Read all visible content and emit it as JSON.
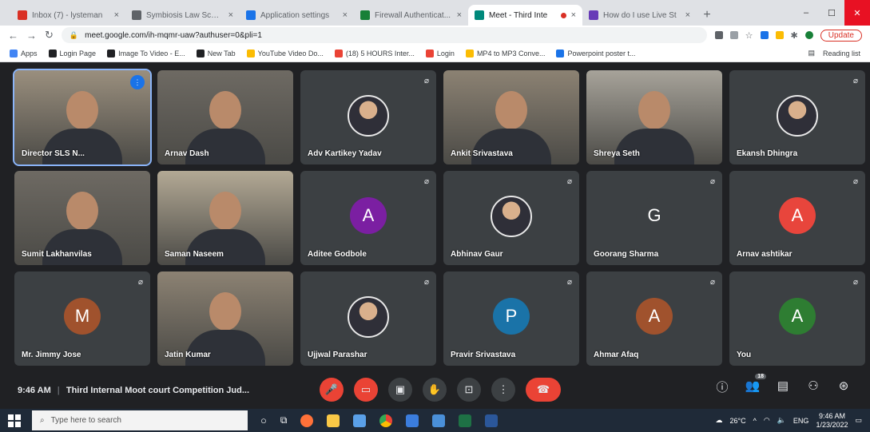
{
  "browser": {
    "tabs": [
      {
        "label": "Inbox (7) - lysteman",
        "color": "#d93025",
        "active": false
      },
      {
        "label": "Symbiosis Law School",
        "color": "#5f6368",
        "active": false
      },
      {
        "label": "Application settings",
        "color": "#1a73e8",
        "active": false
      },
      {
        "label": "Firewall Authenticat...",
        "color": "#188038",
        "active": false
      },
      {
        "label": "Meet - Third Inte",
        "color": "#00897b",
        "active": true
      },
      {
        "label": "How do I use Live St",
        "color": "#673ab7",
        "active": false
      }
    ],
    "new_tab": "+",
    "window_controls": {
      "minimize": "–",
      "maximize": "☐",
      "close": "✕"
    },
    "url": "meet.google.com/ih-mqmr-uaw?authuser=0&pli=1",
    "update_label": "Update",
    "bookmarks": [
      {
        "label": "Apps",
        "color": "#4285f4"
      },
      {
        "label": "Login Page",
        "color": "#202124"
      },
      {
        "label": "Image To Video - E...",
        "color": "#202124"
      },
      {
        "label": "New Tab",
        "color": "#202124"
      },
      {
        "label": "YouTube Video Do...",
        "color": "#fbbc04"
      },
      {
        "label": "(18) 5 HOURS Inter...",
        "color": "#ea4335"
      },
      {
        "label": "Login",
        "color": "#ea4335"
      },
      {
        "label": "MP4 to MP3 Conve...",
        "color": "#fbbc04"
      },
      {
        "label": "Powerpoint poster t...",
        "color": "#1a73e8"
      }
    ],
    "reading_list": "Reading list"
  },
  "participants": [
    {
      "name": "Director SLS N...",
      "type": "video",
      "speaking": true
    },
    {
      "name": "Arnav Dash",
      "type": "video"
    },
    {
      "name": "Adv Kartikey Yadav",
      "type": "photo"
    },
    {
      "name": "Ankit Srivastava",
      "type": "video"
    },
    {
      "name": "Shreya Seth",
      "type": "video"
    },
    {
      "name": "Ekansh Dhingra",
      "type": "photo"
    },
    {
      "name": "Sumit Lakhanvilas",
      "type": "video"
    },
    {
      "name": "Saman Naseem",
      "type": "video"
    },
    {
      "name": "Aditee Godbole",
      "type": "letter",
      "letter": "A",
      "color": "#7b1fa2"
    },
    {
      "name": "Abhinav Gaur",
      "type": "photo"
    },
    {
      "name": "Goorang Sharma",
      "type": "letter",
      "letter": "G",
      "color": "#3c4043"
    },
    {
      "name": "Arnav ashtikar",
      "type": "letter",
      "letter": "A",
      "color": "#e8453c"
    },
    {
      "name": "Mr. Jimmy Jose",
      "type": "letter",
      "letter": "M",
      "color": "#a0522d"
    },
    {
      "name": "Jatin Kumar",
      "type": "video"
    },
    {
      "name": "Ujjwal Parashar",
      "type": "photo"
    },
    {
      "name": "Pravir Srivastava",
      "type": "letter",
      "letter": "P",
      "color": "#1a73a8"
    },
    {
      "name": "Ahmar Afaq",
      "type": "letter",
      "letter": "A",
      "color": "#a0522d"
    },
    {
      "name": "You",
      "type": "letter",
      "letter": "A",
      "color": "#2e7d32"
    }
  ],
  "meet": {
    "time": "9:46 AM",
    "title": "Third Internal Moot court Competition Jud...",
    "people_count": "18"
  },
  "taskbar": {
    "search_placeholder": "Type here to search",
    "temperature": "26°C",
    "language": "ENG",
    "clock_time": "9:46 AM",
    "clock_date": "1/23/2022"
  }
}
